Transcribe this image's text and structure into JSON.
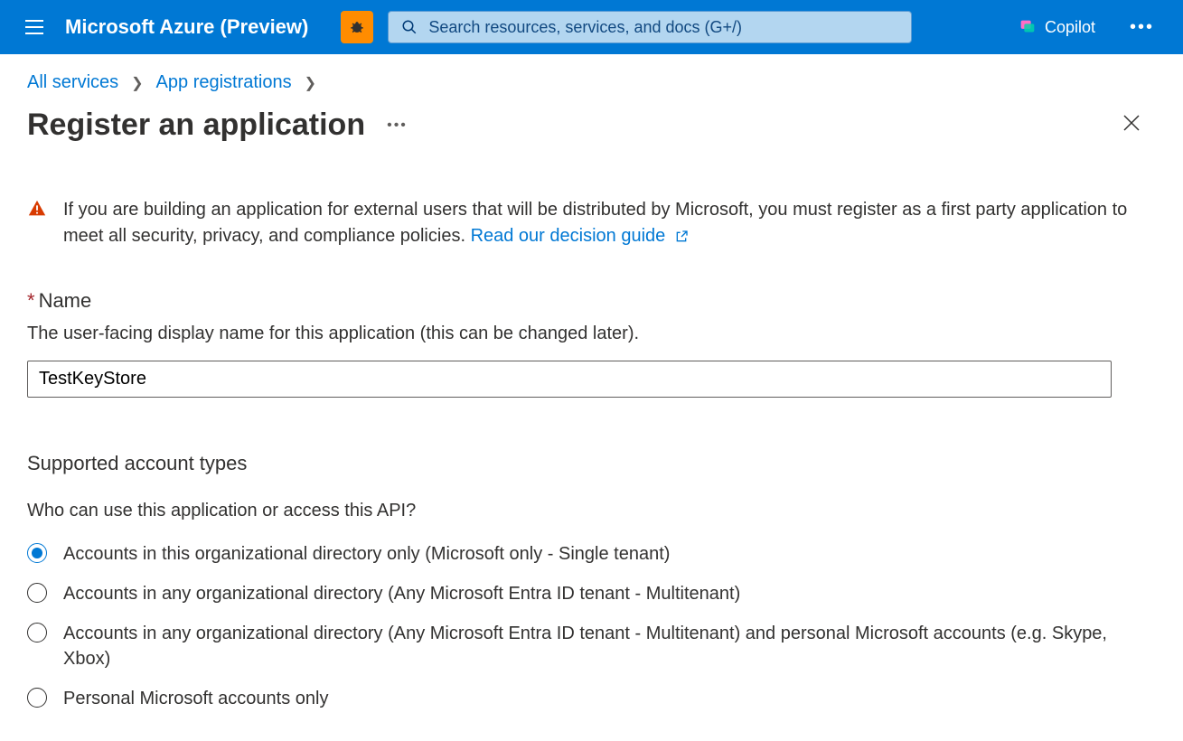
{
  "header": {
    "brand": "Microsoft Azure (Preview)",
    "search_placeholder": "Search resources, services, and docs (G+/)",
    "copilot_label": "Copilot"
  },
  "breadcrumb": {
    "item1": "All services",
    "item2": "App registrations"
  },
  "page": {
    "title": "Register an application"
  },
  "banner": {
    "text_before": "If you are building an application for external users that will be distributed by Microsoft, you must register as a first party application to meet all security, privacy, and compliance policies. ",
    "link": "Read our decision guide"
  },
  "name_field": {
    "label": "Name",
    "hint": "The user-facing display name for this application (this can be changed later).",
    "value": "TestKeyStore"
  },
  "account_types": {
    "title": "Supported account types",
    "question": "Who can use this application or access this API?",
    "options": [
      {
        "label": "Accounts in this organizational directory only (Microsoft only - Single tenant)",
        "checked": true
      },
      {
        "label": "Accounts in any organizational directory (Any Microsoft Entra ID tenant - Multitenant)",
        "checked": false
      },
      {
        "label": "Accounts in any organizational directory (Any Microsoft Entra ID tenant - Multitenant) and personal Microsoft accounts (e.g. Skype, Xbox)",
        "checked": false
      },
      {
        "label": "Personal Microsoft accounts only",
        "checked": false
      }
    ]
  }
}
